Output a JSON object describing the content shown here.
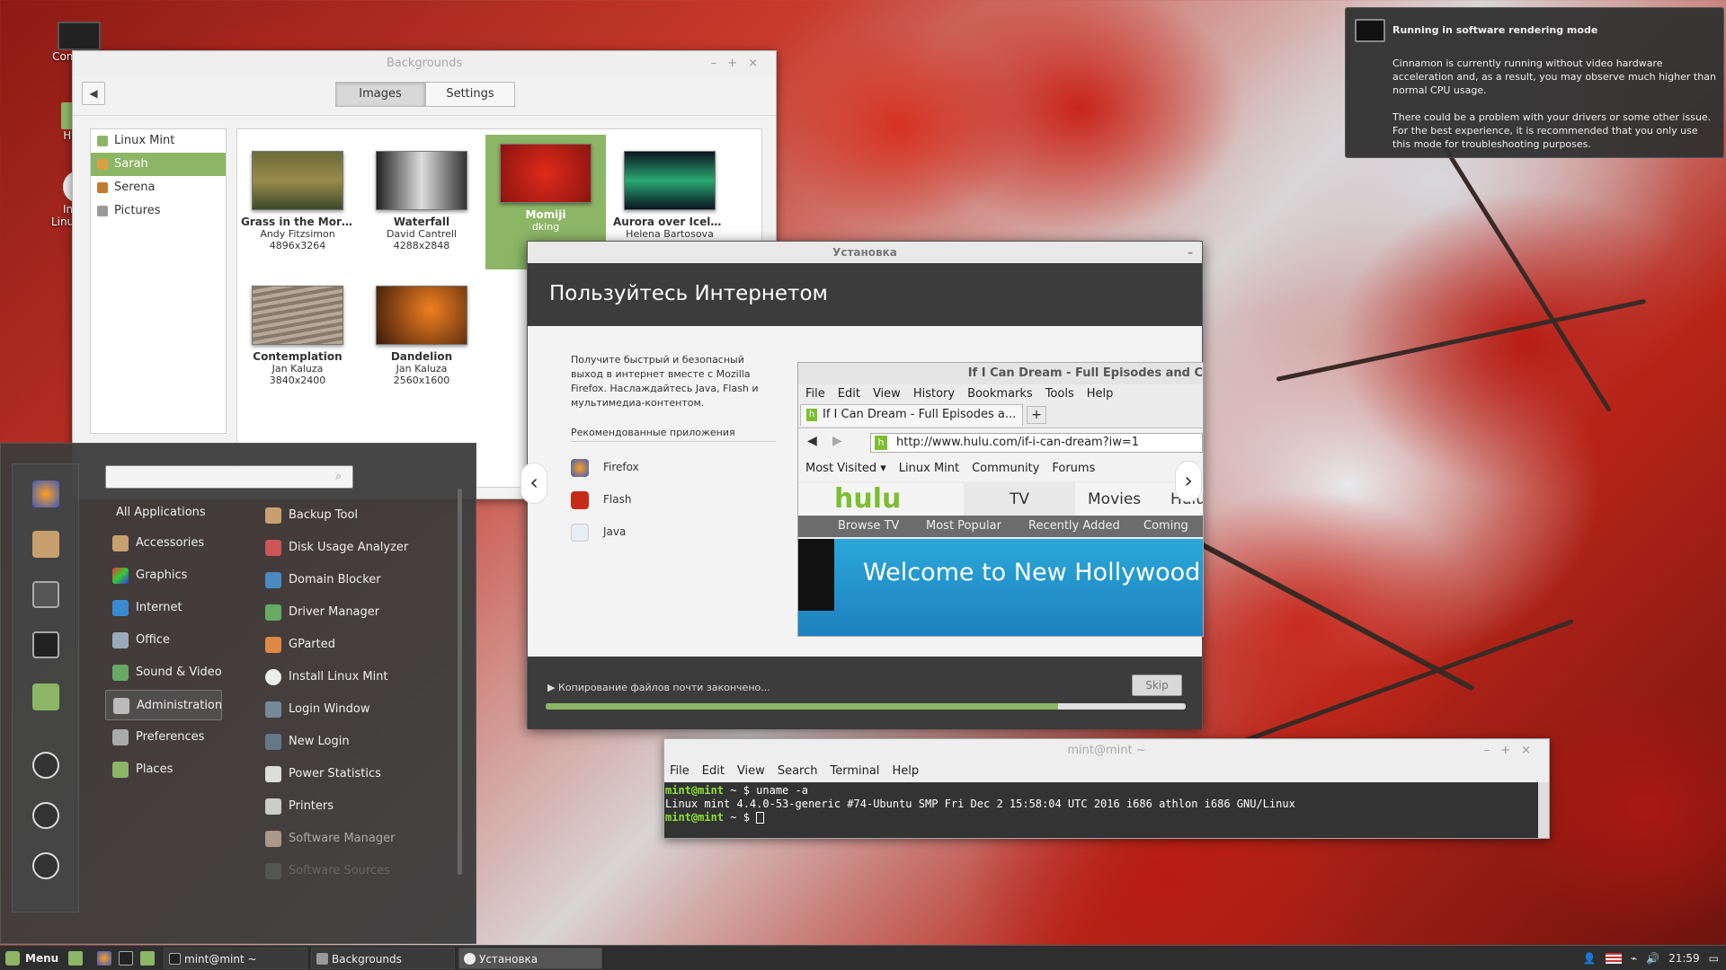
{
  "desktop": {
    "icons": [
      {
        "label": "Computer"
      },
      {
        "label": "Home"
      },
      {
        "label": "Install Linux Mint"
      }
    ]
  },
  "backgrounds_window": {
    "title": "Backgrounds",
    "back_icon": "arrow-left-icon",
    "tabs": [
      "Images",
      "Settings"
    ],
    "active_tab": "Images",
    "sidebar": [
      "Linux Mint",
      "Sarah",
      "Serena",
      "Pictures"
    ],
    "selected_sidebar": "Sarah",
    "thumbnails": [
      {
        "name": "Grass in the Morn...",
        "author": "Andy Fitzsimon",
        "size": "4896x3264"
      },
      {
        "name": "Waterfall",
        "author": "David Cantrell",
        "size": "4288x2848"
      },
      {
        "name": "Momiji",
        "author": "dking",
        "size": ""
      },
      {
        "name": "Aurora over Icela...",
        "author": "Helena Bartosova",
        "size": ""
      },
      {
        "name": "Contemplation",
        "author": "Jan Kaluza",
        "size": "3840x2400"
      },
      {
        "name": "Dandelion",
        "author": "Jan Kaluza",
        "size": "2560x1600"
      }
    ],
    "selected_thumbnail": "Momiji"
  },
  "notification": {
    "title": "Running in software rendering mode",
    "body1": "Cinnamon is currently running without video hardware acceleration and, as a result, you may observe much higher than normal CPU usage.",
    "body2": "There could be a problem with your drivers or some other issue.  For the best experience, it is recommended that you only use this mode for troubleshooting purposes."
  },
  "installer": {
    "title": "Установка",
    "heading": "Пользуйтесь Интернетом",
    "description": "Получите быстрый и безопасный выход в интернет вместе с Mozilla Firefox. Наслаждайтесь Java, Flash и мультимедиа-контентом.",
    "recommended_header": "Рекомендованные приложения",
    "apps": [
      "Firefox",
      "Flash",
      "Java"
    ],
    "firefox": {
      "title": "If I Can Dream - Full Episodes and C",
      "menu": [
        "File",
        "Edit",
        "View",
        "History",
        "Bookmarks",
        "Tools",
        "Help"
      ],
      "tab_label": "If I Can Dream - Full Episodes a...",
      "url": "http://www.hulu.com/if-i-can-dream?iw=1",
      "bookmarks": [
        "Most Visited ▾",
        "Linux Mint",
        "Community",
        "Forums"
      ],
      "hulu_logo": "hulu",
      "hulu_tabs": [
        "TV",
        "Movies",
        "Hulu Plus"
      ],
      "hulu_sub": [
        "Browse TV",
        "Most Popular",
        "Recently Added",
        "Coming"
      ],
      "banner": "Welcome to New Hollywood."
    },
    "status": "Копирование файлов почти закончено...",
    "skip_label": "Skip",
    "progress": 0.8
  },
  "terminal": {
    "title": "mint@mint ~",
    "menu": [
      "File",
      "Edit",
      "View",
      "Search",
      "Terminal",
      "Help"
    ],
    "lines": [
      {
        "prompt": "mint@mint",
        "sep": " ~ $ ",
        "text": "uname -a"
      },
      {
        "prompt": "",
        "sep": "",
        "text": "Linux mint 4.4.0-53-generic #74-Ubuntu SMP Fri Dec 2 15:58:04 UTC 2016 i686 athlon i686 GNU/Linux"
      },
      {
        "prompt": "mint@mint",
        "sep": " ~ $ ",
        "text": ""
      }
    ]
  },
  "menu": {
    "search_placeholder": "",
    "categories": [
      "All Applications",
      "Accessories",
      "Graphics",
      "Internet",
      "Office",
      "Sound & Video",
      "Administration",
      "Preferences",
      "Places"
    ],
    "highlighted_category": "Administration",
    "apps": [
      "Backup Tool",
      "Disk Usage Analyzer",
      "Domain Blocker",
      "Driver Manager",
      "GParted",
      "Install Linux Mint",
      "Login Window",
      "New Login",
      "Power Statistics",
      "Printers",
      "Software Manager",
      "Software Sources"
    ]
  },
  "taskbar": {
    "menu_label": "Menu",
    "windows": [
      {
        "label": "mint@mint ~"
      },
      {
        "label": "Backgrounds"
      },
      {
        "label": "Установка"
      }
    ],
    "clock": "21:59"
  }
}
